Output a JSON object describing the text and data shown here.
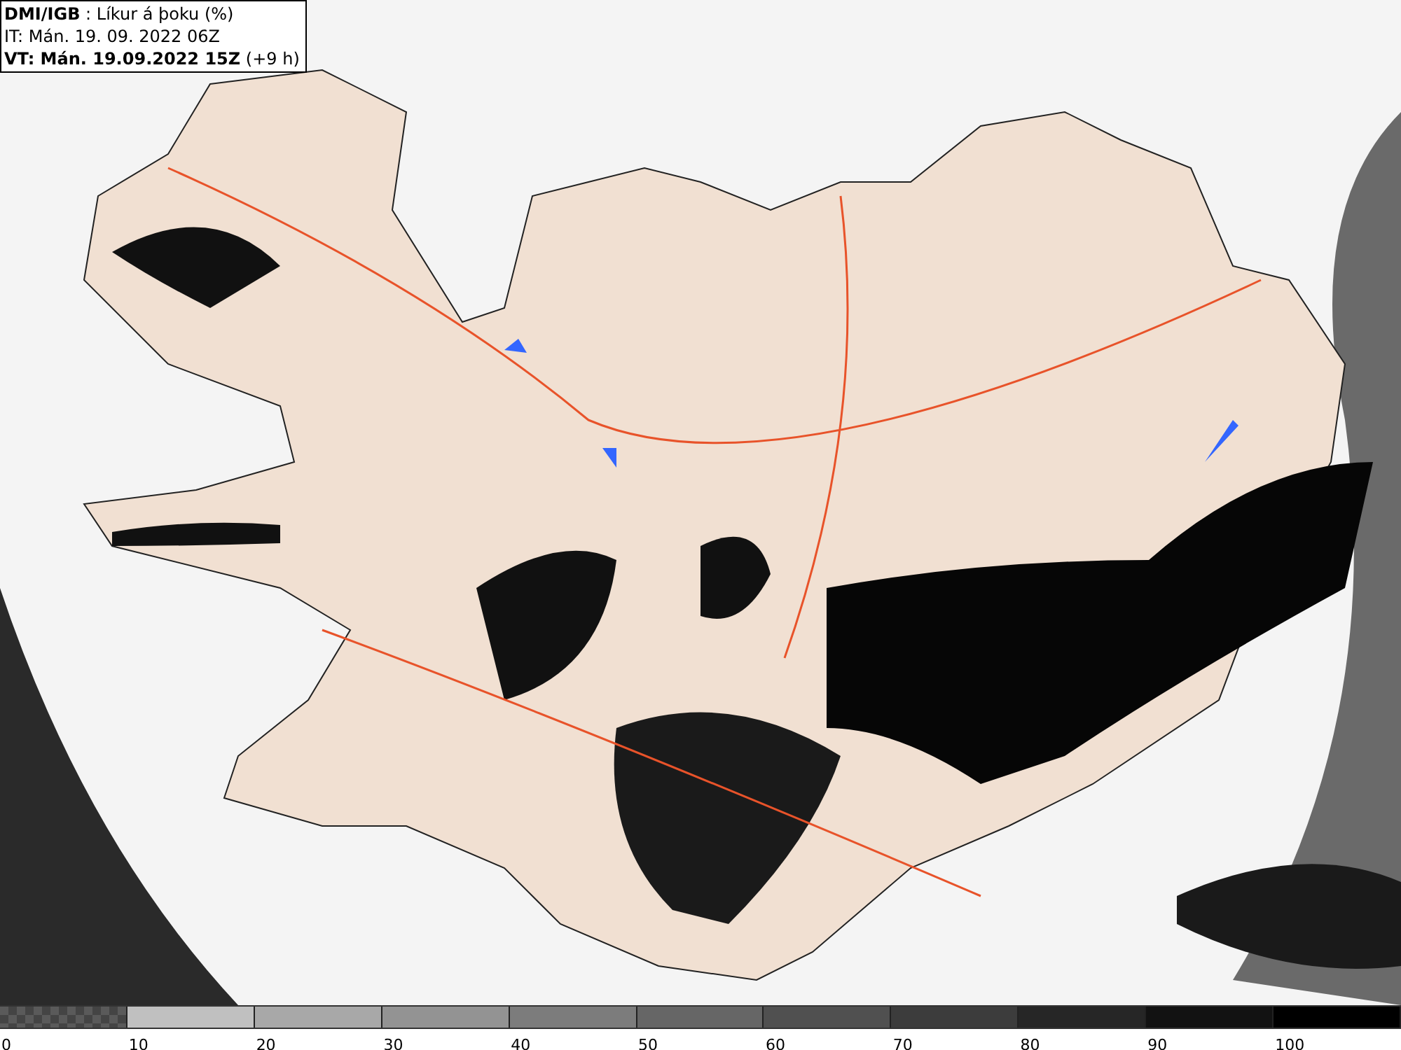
{
  "title_box": {
    "lines": [
      "**DMI/IGB** : Líkur á þoku (%)",
      "IT: Mán. 19. 09. 2022 06Z",
      "**VT: Mán. 19.09.2022 15Z** (+9 h)"
    ]
  },
  "legend": {
    "bins": [
      {
        "kind": "checker",
        "color": "#5a5a5a"
      },
      {
        "kind": "fill",
        "color": "#c0c0c0"
      },
      {
        "kind": "fill",
        "color": "#a8a8a8"
      },
      {
        "kind": "fill",
        "color": "#939393"
      },
      {
        "kind": "fill",
        "color": "#7c7c7c"
      },
      {
        "kind": "fill",
        "color": "#666666"
      },
      {
        "kind": "fill",
        "color": "#505050"
      },
      {
        "kind": "fill",
        "color": "#3c3c3c"
      },
      {
        "kind": "fill",
        "color": "#262626"
      },
      {
        "kind": "fill",
        "color": "#121212"
      },
      {
        "kind": "fill",
        "color": "#000000"
      }
    ],
    "labels": [
      "0",
      "10",
      "20",
      "30",
      "40",
      "50",
      "60",
      "70",
      "80",
      "90",
      "100"
    ]
  }
}
